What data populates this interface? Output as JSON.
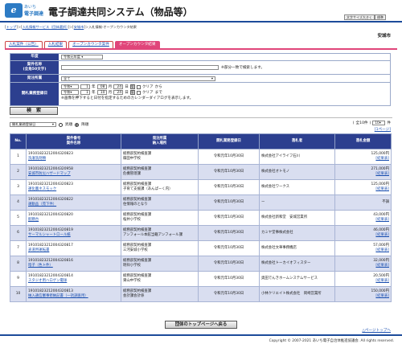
{
  "header": {
    "logo_glyph": "e",
    "logo_line1": "あいち",
    "logo_line2": "電子調達",
    "title": "電子調達共同システム（物品等）",
    "fontsize_large": "文字サイズ大きく",
    "fontsize_std": "標準"
  },
  "breadcrumb": {
    "items": [
      "トップ",
      "入札情報サービス（団体選択）",
      "安城市"
    ],
    "current": "入札情報-オープンカウンタ結果"
  },
  "org_name": "安城市",
  "tabs": [
    "入札案件（公告）",
    "入札結果",
    "オープンカウンタ案件",
    "オープンカウンタ結果"
  ],
  "form": {
    "year_label": "年度",
    "year_value": "令和元年度",
    "name_label": "案件名称",
    "name_sub": "(全角50文字)",
    "name_note": "※部分一致で検索します。",
    "section_label": "発注所属",
    "section_value": "全て",
    "date_label": "開札業務登録日",
    "era": "令和",
    "from": {
      "y": "1",
      "m": "08",
      "d": "24"
    },
    "to": {
      "y": "1",
      "m": "10",
      "d": "24"
    },
    "year_unit": "年",
    "month_unit": "月",
    "day_unit": "日",
    "cal_glyph": "暦",
    "clear": "クリア",
    "from_suffix": "から",
    "to_suffix": "まで",
    "cal_note": "※画像を押下すると日付を指定するためのカレンダーダイアログを表示します。",
    "search": "検　索"
  },
  "controls": {
    "sort_value": "開札業務登録日",
    "asc": "昇順",
    "desc": "降順",
    "total": "全10件",
    "per_page": "10",
    "per_page_unit": "件",
    "page_link": "1ページ"
  },
  "table": {
    "headers": {
      "no": "No.",
      "case": "案件番号\n案件名称",
      "section": "発注所属\n納入場所",
      "date": "開札業務登録日",
      "winner": "落札者",
      "amount": "落札金額"
    },
    "rows": [
      {
        "no": "1",
        "id": "19101823212004320823",
        "name": "洗濯洗剤類",
        "sec": "総務部契約検査課",
        "place": "篠田中学校",
        "date": "令和元年10月30日",
        "winner": "株式会社アイライフ石川",
        "amount": "125,000円",
        "link": "[結果表]"
      },
      {
        "no": "2",
        "id": "19101823212004320958",
        "name": "安城市防災ハザードマップ",
        "sec": "総務部契約検査課",
        "place": "危機管理課",
        "date": "令和元年10月30日",
        "winner": "株式会社オトモノ",
        "amount": "271,000円",
        "link": "[結果表]"
      },
      {
        "no": "3",
        "id": "19101823212004320823",
        "name": "運化農ネスモック",
        "sec": "総務部契約検査課",
        "place": "子育て支援課（あんぱーく内）",
        "date": "令和元年10月30日",
        "winner": "株式会社ワークス",
        "amount": "125,000円",
        "link": "[結果表]"
      },
      {
        "no": "4",
        "id": "19101823212004320822",
        "name": "運動品（苑下件）",
        "sec": "総務部契約検査課",
        "place": "住情報のとなり",
        "date": "令和元年10月30日",
        "winner": "ー",
        "amount": "不調",
        "link": ""
      },
      {
        "no": "5",
        "id": "19101823212004320820",
        "name": "配膳台",
        "sec": "総務部契約検査課",
        "place": "桜井小学校",
        "date": "令和元年10月30日",
        "winner": "株式会社新和堂　安城営業所",
        "amount": "43,000円",
        "link": "[結果表]"
      },
      {
        "no": "6",
        "id": "19101823212004320819",
        "name": "サーマルシャートロール紙",
        "sec": "総務部契約検査課",
        "place": "アンフォール本館当籍アンフォール課",
        "date": "令和元年10月30日",
        "winner": "カミヤ堂事株式会社",
        "amount": "46,000円",
        "link": "[結果表]"
      },
      {
        "no": "7",
        "id": "19101823212004320817",
        "name": "表道用運転書",
        "sec": "総務部契約検査課",
        "place": "三河安城小学校",
        "date": "令和元年10月30日",
        "winner": "株式会社文華事務機店",
        "amount": "57,000円",
        "link": "[結果表]"
      },
      {
        "no": "8",
        "id": "19101823212004320816",
        "name": "暗子（色ト件）",
        "sec": "総務部契約検査課",
        "place": "明祥小学校",
        "date": "令和元年10月30日",
        "winner": "株式会社トーカイオフィスター",
        "amount": "32,000円",
        "link": "[結果表]"
      },
      {
        "no": "9",
        "id": "19101823212004320814",
        "name": "スタジオ用ハロゲン電球",
        "sec": "総務部契約検査課",
        "place": "東山中学校",
        "date": "令和元年10月30日",
        "winner": "奥田でんきホームシステムサービス",
        "amount": "20,500円",
        "link": "[結果表]"
      },
      {
        "no": "10",
        "id": "19101823212004320813",
        "name": "納入通信審事修納記書（一括調査用）",
        "sec": "総務部契約検査課",
        "place": "会計課会計係",
        "date": "令和元年10月30日",
        "winner": "小林クリエイト株式会社　岡崎営業所",
        "amount": "150,000円",
        "link": "[結果表]"
      }
    ]
  },
  "bottom": {
    "top_button": "団体のトップページへ戻る",
    "page_top": "△ページトップへ",
    "copyright": "Copyright © 2007-2021 あいち電子自治体推進協議会. All rights reserved."
  }
}
